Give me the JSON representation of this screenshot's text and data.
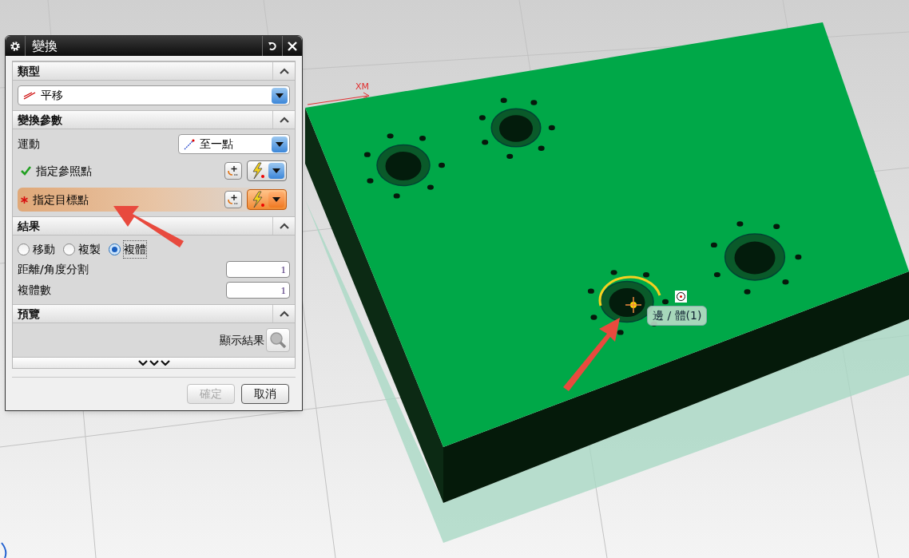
{
  "dialog": {
    "title": "變換"
  },
  "type_section": {
    "title": "類型",
    "expanded": true,
    "dropdown": "平移"
  },
  "params_section": {
    "title": "變換參數",
    "expanded": true,
    "motion_label": "運動",
    "motion_dropdown": "至一點",
    "rows": [
      {
        "label": "指定參照點",
        "kind": "done",
        "active": false
      },
      {
        "label": "指定目標點",
        "kind": "required",
        "active": true
      }
    ]
  },
  "result_section": {
    "title": "結果",
    "expanded": true,
    "options": [
      {
        "label": "移動",
        "selected": false
      },
      {
        "label": "複製",
        "selected": false
      },
      {
        "label": "複體",
        "selected": true
      }
    ],
    "fields": [
      {
        "label": "距離/角度分割",
        "value": "1"
      },
      {
        "label": "複體數",
        "value": "1"
      }
    ]
  },
  "preview_section": {
    "title": "預覽",
    "expanded": true,
    "show_result": "顯示結果"
  },
  "buttons": [
    {
      "label": "確定",
      "disabled": true
    },
    {
      "label": "取消",
      "disabled": false
    }
  ],
  "viewport": {
    "axis_label": "XM",
    "tooltip": "邊 / 體(1)"
  }
}
